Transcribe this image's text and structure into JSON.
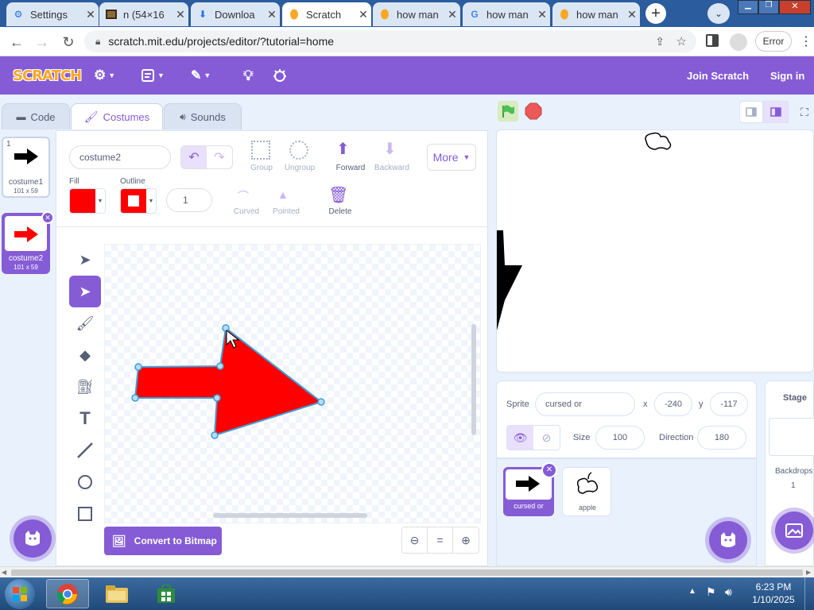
{
  "browser": {
    "tabs": [
      {
        "title": "Settings",
        "icon": "gear-icon",
        "active": false
      },
      {
        "title": "n (54×16",
        "icon": "video-icon",
        "active": false
      },
      {
        "title": "Downloa",
        "icon": "download-icon",
        "active": false
      },
      {
        "title": "Scratch",
        "icon": "scratch-icon",
        "active": true
      },
      {
        "title": "how man",
        "icon": "scratch-icon",
        "active": false
      },
      {
        "title": "how man",
        "icon": "google-icon",
        "active": false
      },
      {
        "title": "how man",
        "icon": "scratch-icon",
        "active": false
      }
    ],
    "url": "scratch.mit.edu/projects/editor/?tutorial=home",
    "error_label": "Error"
  },
  "menubar": {
    "logo": "SCRATCH",
    "join": "Join Scratch",
    "signin": "Sign in"
  },
  "editor_tabs": {
    "code": "Code",
    "costumes": "Costumes",
    "sounds": "Sounds"
  },
  "costumes": [
    {
      "index": "1",
      "name": "costume1",
      "size": "101 x 59",
      "selected": false,
      "color": "#000000"
    },
    {
      "index": "2",
      "name": "costume2",
      "size": "101 x 59",
      "selected": true,
      "color": "#ff0000"
    }
  ],
  "paint": {
    "costume_name": "costume2",
    "group": "Group",
    "ungroup": "Ungroup",
    "forward": "Forward",
    "backward": "Backward",
    "more": "More",
    "fill_label": "Fill",
    "outline_label": "Outline",
    "outline_width": "1",
    "curved": "Curved",
    "pointed": "Pointed",
    "delete": "Delete",
    "convert": "Convert to Bitmap",
    "fill_color": "#ff0000",
    "outline_color": "#ff0000",
    "zoom_reset": "="
  },
  "sprite": {
    "label": "Sprite",
    "name": "cursed or",
    "x_label": "x",
    "x": "-240",
    "y_label": "y",
    "y": "-117",
    "size_label": "Size",
    "size": "100",
    "direction_label": "Direction",
    "direction": "180"
  },
  "sprites": [
    {
      "name": "cursed or",
      "selected": true
    },
    {
      "name": "apple",
      "selected": false
    }
  ],
  "stage_pane": {
    "title": "Stage",
    "backdrops_label": "Backdrops",
    "backdrops_count": "1"
  },
  "taskbar": {
    "time": "6:23 PM",
    "date": "1/10/2025"
  },
  "colors": {
    "accent": "#855cd6",
    "tab_bar": "#2b5c9e",
    "arrow_fill": "#ff0000"
  }
}
